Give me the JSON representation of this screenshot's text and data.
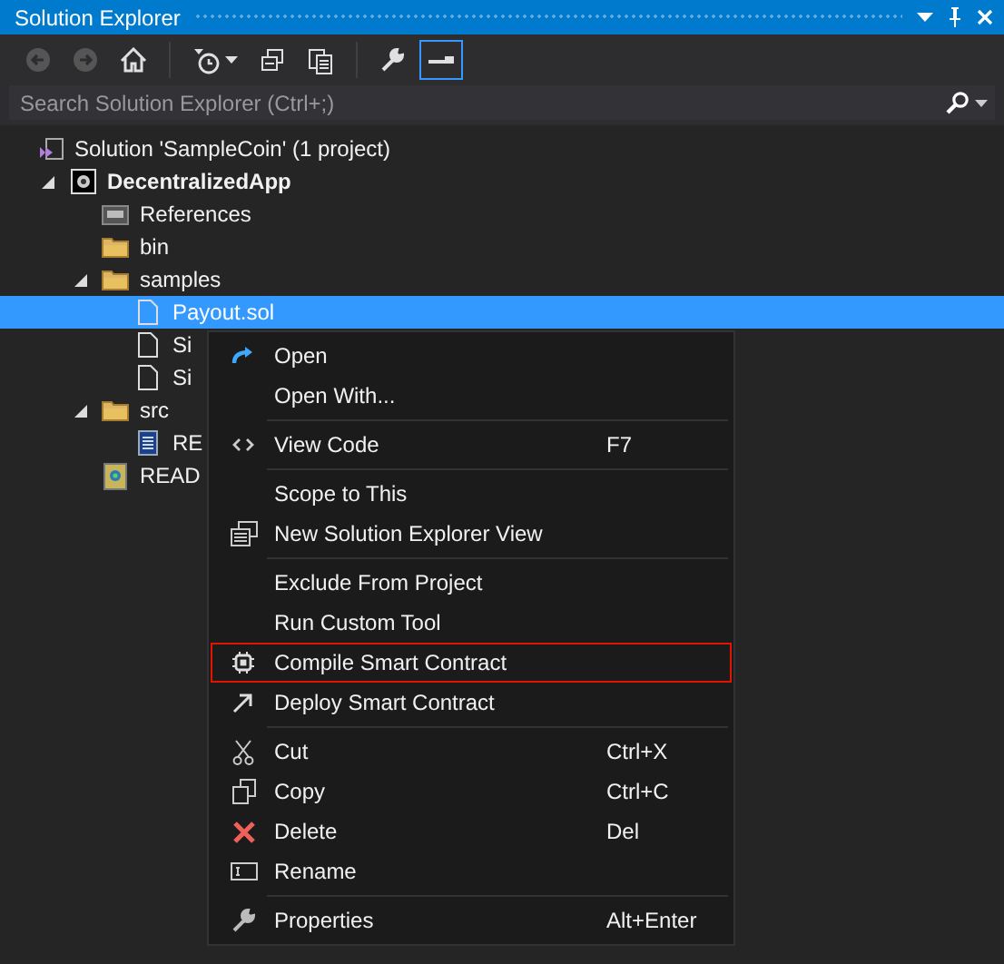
{
  "window": {
    "title": "Solution Explorer"
  },
  "toolbar": [
    {
      "kind": "back",
      "disabled": true,
      "selected": false
    },
    {
      "kind": "forward",
      "disabled": true,
      "selected": false
    },
    {
      "kind": "home",
      "disabled": false,
      "selected": false
    },
    {
      "kind": "separator"
    },
    {
      "kind": "history",
      "disabled": false,
      "selected": false
    },
    {
      "kind": "collapse",
      "disabled": false,
      "selected": false
    },
    {
      "kind": "show-all",
      "disabled": false,
      "selected": false
    },
    {
      "kind": "separator"
    },
    {
      "kind": "properties",
      "disabled": false,
      "selected": false
    },
    {
      "kind": "preview",
      "disabled": false,
      "selected": true
    }
  ],
  "search": {
    "placeholder": "Search Solution Explorer (Ctrl+;)"
  },
  "tree": [
    {
      "label": "Solution 'SampleCoin' (1 project)",
      "kind": "solution",
      "selected": false,
      "children": [
        {
          "label": "DecentralizedApp",
          "kind": "project",
          "expanded": true,
          "selected": false,
          "children": [
            {
              "label": "References",
              "kind": "references",
              "selected": false
            },
            {
              "label": "bin",
              "kind": "folder",
              "expanded": false,
              "selected": false
            },
            {
              "label": "samples",
              "kind": "folder",
              "expanded": true,
              "selected": false,
              "children": [
                {
                  "label": "Payout.sol",
                  "kind": "file",
                  "selected": true
                },
                {
                  "label": "Si",
                  "kind": "file",
                  "selected": false
                },
                {
                  "label": "Si",
                  "kind": "file",
                  "selected": false
                }
              ]
            },
            {
              "label": "src",
              "kind": "folder",
              "expanded": true,
              "selected": false,
              "children": [
                {
                  "label": "RE",
                  "kind": "code",
                  "selected": false
                }
              ]
            },
            {
              "label": "READ",
              "kind": "readme",
              "selected": false
            }
          ]
        }
      ]
    }
  ],
  "context_menu": {
    "groups": [
      [
        {
          "label": "Open",
          "kind": "open",
          "highlighted": false
        },
        {
          "label": "Open With...",
          "kind": "plain",
          "highlighted": false
        }
      ],
      [
        {
          "label": "View Code",
          "kind": "code",
          "shortcut": "F7",
          "highlighted": false
        }
      ],
      [
        {
          "label": "Scope to This",
          "kind": "plain",
          "highlighted": false
        },
        {
          "label": "New Solution Explorer View",
          "kind": "new-view",
          "highlighted": false
        }
      ],
      [
        {
          "label": "Exclude From Project",
          "kind": "plain",
          "highlighted": false
        },
        {
          "label": "Run Custom Tool",
          "kind": "plain",
          "highlighted": false
        },
        {
          "label": "Compile Smart Contract",
          "kind": "chip",
          "highlighted": true
        },
        {
          "label": "Deploy Smart Contract",
          "kind": "deploy",
          "highlighted": false
        }
      ],
      [
        {
          "label": "Cut",
          "kind": "cut",
          "shortcut": "Ctrl+X",
          "highlighted": false
        },
        {
          "label": "Copy",
          "kind": "copy",
          "shortcut": "Ctrl+C",
          "highlighted": false
        },
        {
          "label": "Delete",
          "kind": "delete",
          "shortcut": "Del",
          "highlighted": false
        },
        {
          "label": "Rename",
          "kind": "rename",
          "highlighted": false
        }
      ],
      [
        {
          "label": "Properties",
          "kind": "wrench",
          "shortcut": "Alt+Enter",
          "highlighted": false
        }
      ]
    ]
  }
}
